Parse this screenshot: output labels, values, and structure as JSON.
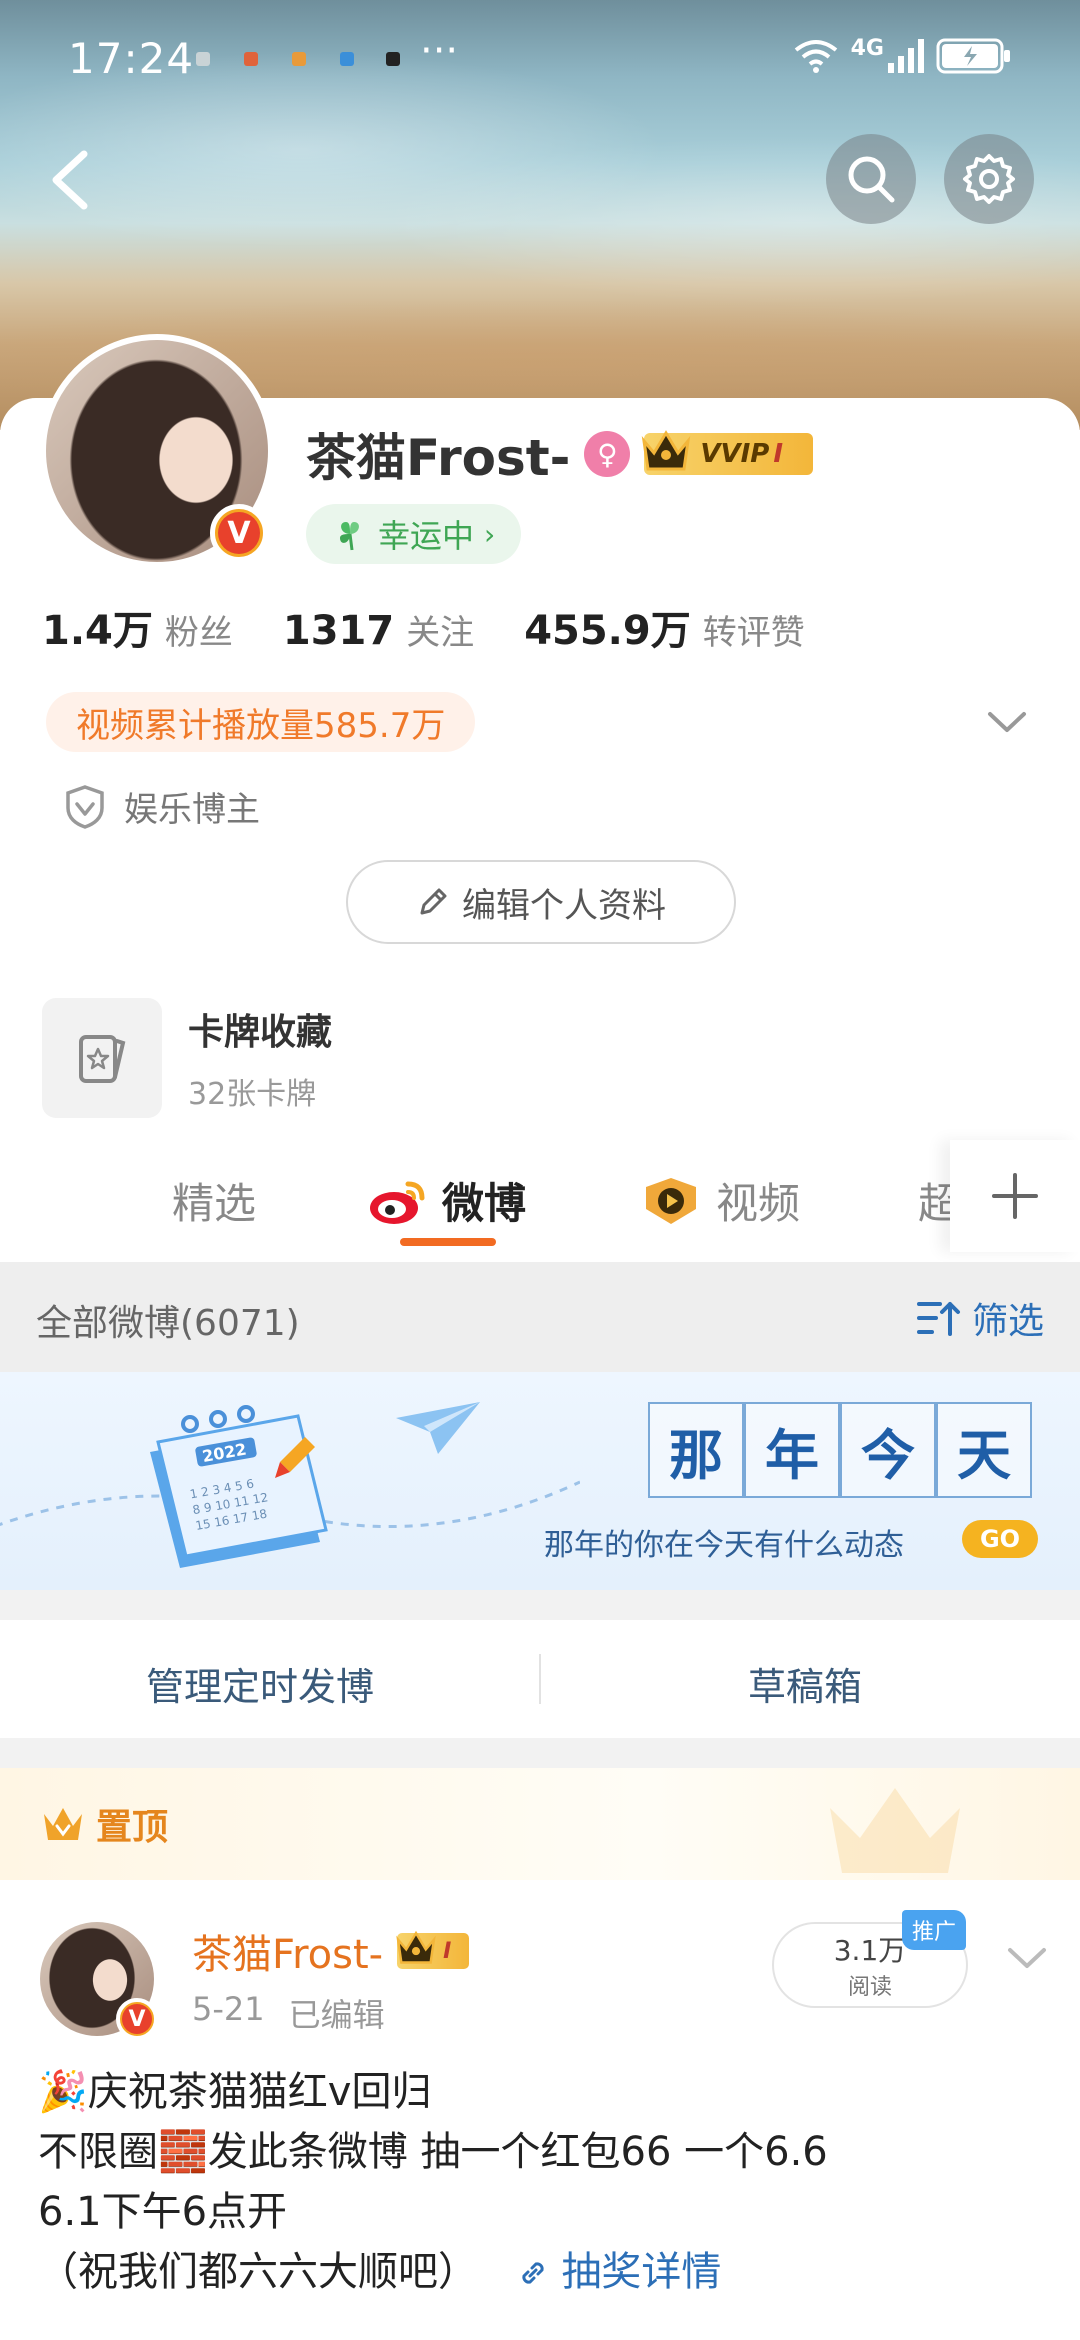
{
  "status_bar": {
    "time": "17:24",
    "more": "···",
    "network": "4G"
  },
  "header": {
    "back_icon": "chevron-left-icon",
    "search_icon": "search-icon",
    "settings_icon": "gear-icon"
  },
  "profile": {
    "username": "茶猫Frost-",
    "gender_icon": "female-icon",
    "vip_label": "VVIP",
    "vip_level": "I",
    "lucky_label": "幸运中",
    "stats": [
      {
        "value": "1.4万",
        "label": "粉丝"
      },
      {
        "value": "1317",
        "label": "关注"
      },
      {
        "value": "455.9万",
        "label": "转评赞"
      }
    ],
    "video_views": "视频累计播放量585.7万",
    "role": "娱乐博主",
    "edit_button": "编辑个人资料",
    "cards": {
      "title": "卡牌收藏",
      "count": "32张卡牌"
    }
  },
  "tabs": [
    {
      "label": "精选",
      "active": false
    },
    {
      "label": "微博",
      "active": true
    },
    {
      "label": "视频",
      "active": false
    },
    {
      "label": "超",
      "active": false
    }
  ],
  "filter_bar": {
    "all_label": "全部微博(6071)",
    "filter_label": "筛选"
  },
  "memory_banner": {
    "title_chars": [
      "那",
      "年",
      "今",
      "天"
    ],
    "subtitle": "那年的你在今天有什么动态",
    "go_label": "GO",
    "calendar_year": "2022"
  },
  "actions": {
    "scheduled": "管理定时发博",
    "drafts": "草稿箱"
  },
  "pinned": {
    "label": "置顶"
  },
  "post": {
    "author": "茶猫Frost-",
    "vip_level": "I",
    "date": "5-21",
    "edited": "已编辑",
    "reads_value": "3.1万",
    "reads_label": "阅读",
    "promo_label": "推广",
    "lines": [
      "🎉庆祝茶猫猫红v回归",
      "不限圈🧱发此条微博 抽一个红包66 一个6.6",
      "6.1下午6点开",
      "（祝我们都六六大顺吧）"
    ],
    "lottery_link": "抽奖详情"
  },
  "colors": {
    "accent_orange": "#f26b22",
    "link_blue": "#2c6fb7",
    "lucky_green": "#3fa654"
  }
}
